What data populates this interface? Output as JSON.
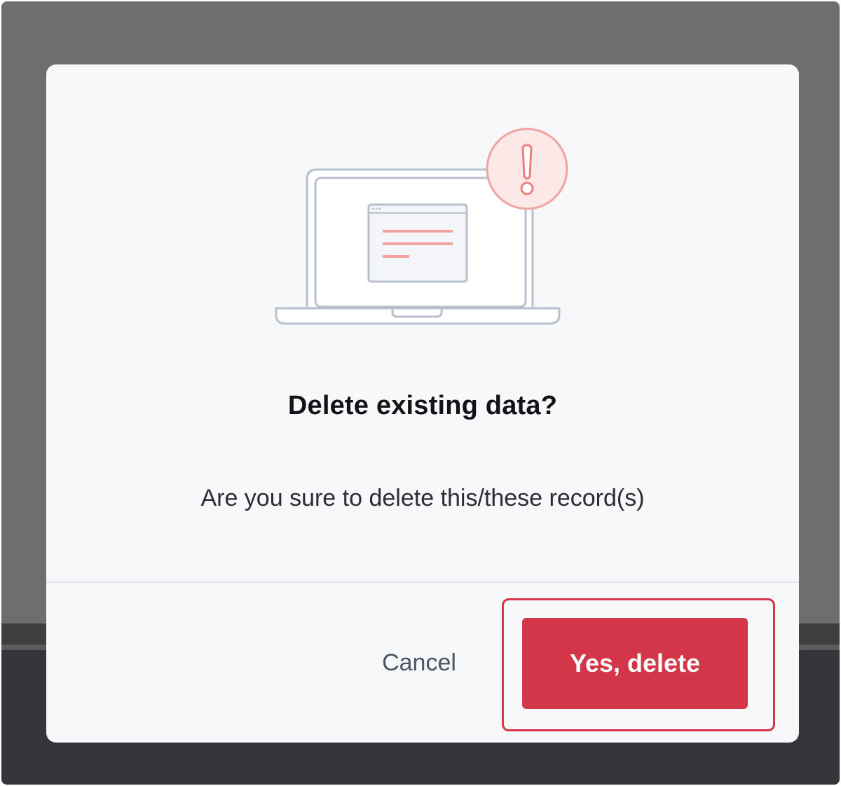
{
  "dialog": {
    "title": "Delete existing data?",
    "message": "Are you sure to delete this/these record(s)",
    "cancel_label": "Cancel",
    "confirm_label": "Yes, delete",
    "illustration_icon": "laptop-with-warning-icon"
  },
  "colors": {
    "danger": "#d33648",
    "warning_badge": "#f4a4a4",
    "overlay": "#6e6e6e",
    "dialog_bg": "#f7f8fa"
  }
}
